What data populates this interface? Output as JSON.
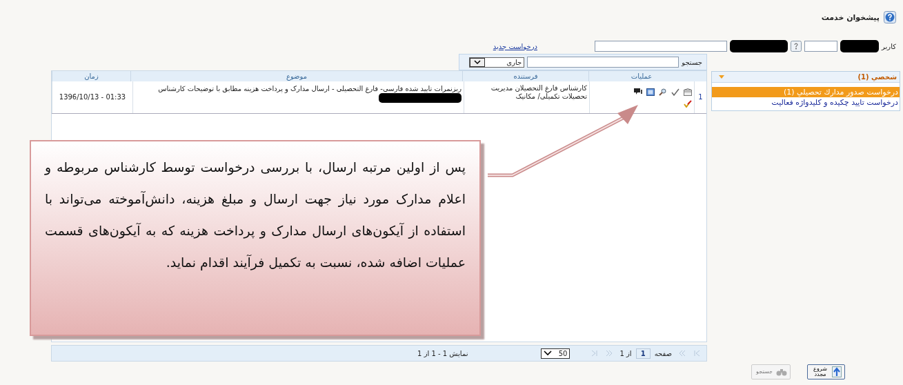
{
  "header": {
    "title": "پیشخوان خدمت"
  },
  "user_filter": {
    "label": "کاربر"
  },
  "new_request_link": "درخواست جدید",
  "sidebar": {
    "group": {
      "label": "شخصي (1)",
      "expanded": true
    },
    "items": [
      {
        "label": "درخواست صدور مدارك تحصيلي (1)",
        "selected": true
      },
      {
        "label": "درخواست تایید چکیده و کلیدواژه فعالیت",
        "selected": false
      }
    ]
  },
  "search": {
    "label": "جستجو",
    "status_select": "جاری"
  },
  "table": {
    "columns": [
      "عملیات",
      "فرستنده",
      "موضوع",
      "زمان"
    ],
    "rows": [
      {
        "index": "1",
        "sender": "کارشناس فارغ التحصیلان مدیریت تحصیلات تکمیلی/ مکانیک",
        "subject": "ریزنمرات تایید شده فارسی- فارغ التحصیلی - ارسال مدارک و پرداخت هزینه مطابق با توضیحات کارشناس",
        "time": "1396/10/13 - 01:33"
      }
    ]
  },
  "pager": {
    "page_label": "صفحه",
    "page": "1",
    "of": "از 1",
    "page_size": "50",
    "summary": "نمایش 1 - 1 از 1"
  },
  "buttons": [
    {
      "kind": "restart",
      "label": "شروع مجدد",
      "disabled": false
    },
    {
      "kind": "search",
      "label": "جستجو",
      "disabled": true
    }
  ],
  "callout": {
    "text": "پس از اولین مرتبه ارسال، با بررسی درخواست توسط کارشناس مربوطه و اعلام مدارک مورد نیاز جهت ارسال و مبلغ هزینه، دانش‌آموخته می‌تواند با استفاده از آیکون‌های ارسال مدارک و پرداخت هزینه که به آیکون‌های قسمت عملیات اضافه شده، نسبت به تکمیل فرآیند اقدام نماید."
  }
}
